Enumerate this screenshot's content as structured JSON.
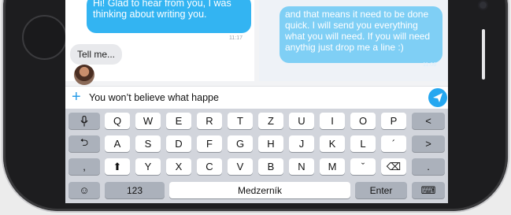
{
  "chat": {
    "left_bubble_line1": "Hi! Glad to hear from you, I was",
    "left_bubble_line2": "thinking about writing you.",
    "left_time": "11:17",
    "gray_bubble": "Tell me...",
    "right_bubble_lines": [
      "and that means it need to be done",
      "quick. I will send you everything",
      "what you will need. If you will need",
      "anythig just drop me a line :)"
    ],
    "right_time": "11:06"
  },
  "composer": {
    "input_value": "You won’t believe what happe",
    "add_icon": "plus-icon",
    "send_icon": "paper-plane-icon",
    "accent": "#25a7f0"
  },
  "keyboard": {
    "row1": [
      "Q",
      "W",
      "E",
      "R",
      "T",
      "Z",
      "U",
      "I",
      "O",
      "P"
    ],
    "row2": [
      "A",
      "S",
      "D",
      "F",
      "G",
      "H",
      "J",
      "K",
      "L",
      "´"
    ],
    "row3": [
      "Y",
      "X",
      "C",
      "V",
      "B",
      "N",
      "M",
      "ˇ"
    ],
    "row1_left": "🎙",
    "row1_right": "<",
    "row2_left": "⮌",
    "row2_right": ">",
    "row3_left": ",",
    "row3_shift": "⬆",
    "row3_delete": "⌫",
    "row3_right": ".",
    "emoji": "☺",
    "numbers": "123",
    "space": "Medzerník",
    "enter": "Enter",
    "hide": "⌨"
  }
}
